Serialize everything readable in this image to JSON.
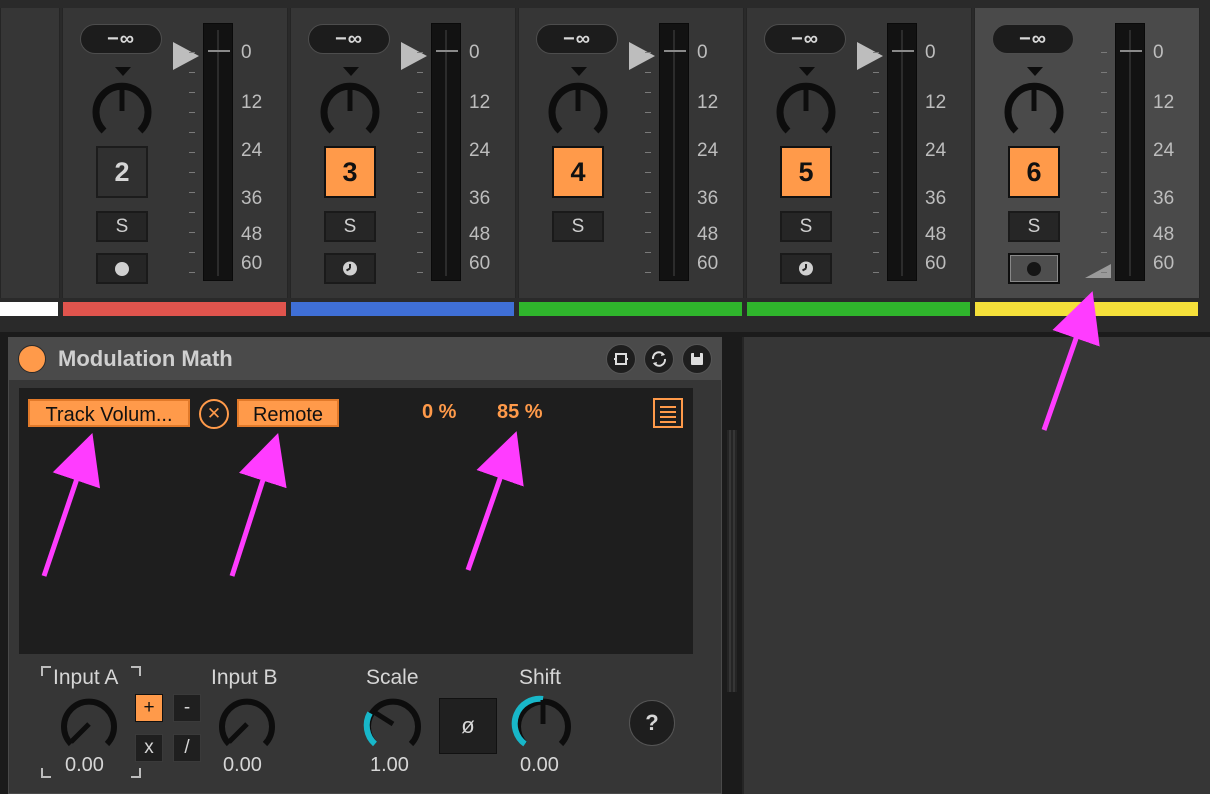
{
  "mixer": {
    "scale_labels": [
      "0",
      "12",
      "24",
      "36",
      "48",
      "60"
    ],
    "strips": [
      {
        "number": "2",
        "volume": "−∞",
        "solo": "S",
        "active": false,
        "arm": "dot",
        "color": "#e0544d"
      },
      {
        "number": "3",
        "volume": "−∞",
        "solo": "S",
        "active": true,
        "arm": "clock",
        "color": "#3f6fd6"
      },
      {
        "number": "4",
        "volume": "−∞",
        "solo": "S",
        "active": true,
        "arm": "none",
        "color": "#2fb52c"
      },
      {
        "number": "5",
        "volume": "−∞",
        "solo": "S",
        "active": true,
        "arm": "clock",
        "color": "#2fb52c"
      },
      {
        "number": "6",
        "volume": "−∞",
        "solo": "S",
        "active": true,
        "arm": "dot-outlined",
        "color": "#f5e03a",
        "selected": true
      }
    ],
    "first_color": "#ffffff"
  },
  "device": {
    "title": "Modulation Math",
    "header_icons": [
      "hot-swap-icon",
      "refresh-icon",
      "save-icon"
    ],
    "display": {
      "source_button": "Track Volum...",
      "clear_icon": "close-icon",
      "target_button": "Remote",
      "min_percent": "0 %",
      "max_percent": "85 %",
      "list_icon": "list-icon"
    },
    "controls": {
      "input_a": {
        "label": "Input A",
        "value": "0.00"
      },
      "input_b": {
        "label": "Input B",
        "value": "0.00"
      },
      "operators": [
        "+",
        "-",
        "x",
        "/"
      ],
      "active_operator": "+",
      "scale": {
        "label": "Scale",
        "value": "1.00"
      },
      "phase": {
        "label": "ø"
      },
      "shift": {
        "label": "Shift",
        "value": "0.00"
      },
      "help": "?"
    },
    "accent": "#ff9a4a",
    "knob_ring": "#18b7c9"
  }
}
